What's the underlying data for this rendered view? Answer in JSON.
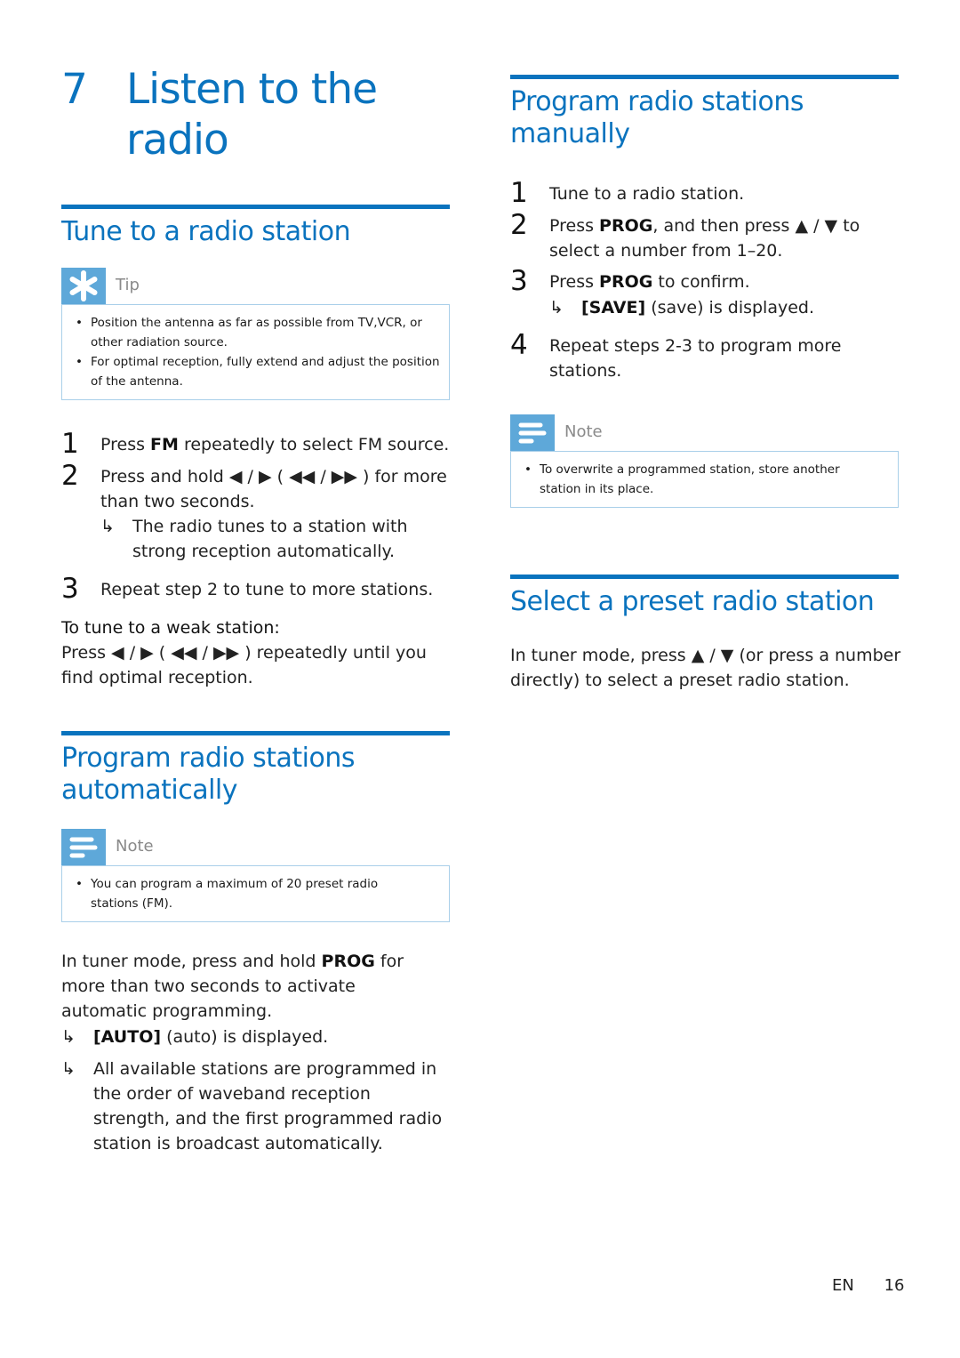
{
  "chapter": {
    "number": "7",
    "title": "Listen to the radio"
  },
  "left": {
    "tune": {
      "heading": "Tune to a radio station",
      "tip": {
        "label": "Tip",
        "icon": "asterisk-icon",
        "items": [
          "Position the antenna as far as possible from TV,VCR, or other radiation source.",
          "For optimal reception, fully extend and adjust the position of the antenna."
        ]
      },
      "steps": [
        {
          "n": "1",
          "pre": "Press ",
          "bold": "FM",
          "post": " repeatedly to select FM source."
        },
        {
          "n": "2",
          "text": "Press and hold ◀ / ▶ ( ◀◀ / ▶▶ ) for more than two seconds."
        },
        {
          "n": "3",
          "text": "Repeat step 2 to tune to more stations."
        }
      ],
      "step2_result": "The radio tunes to a station with strong reception automatically.",
      "weak_heading": "To tune to a weak station:",
      "weak_text": "Press ◀ / ▶ ( ◀◀ / ▶▶ ) repeatedly until you find optimal reception."
    },
    "auto": {
      "heading": "Program radio stations automatically",
      "note": {
        "label": "Note",
        "icon": "note-lines-icon",
        "items": [
          "You can program a maximum of 20 preset radio stations (FM)."
        ]
      },
      "intro_pre": "In tuner mode, press and hold ",
      "intro_bold": "PROG",
      "intro_post": " for more than two seconds to activate automatic programming.",
      "results": [
        {
          "bold": "[AUTO]",
          "text": " (auto) is displayed."
        },
        {
          "bold": "",
          "text": "All available stations are programmed in the order of waveband reception strength, and the first programmed radio station is broadcast automatically."
        }
      ]
    }
  },
  "right": {
    "manual": {
      "heading": "Program radio stations manually",
      "steps": [
        {
          "n": "1",
          "pre": "Tune to a radio station.",
          "bold": "",
          "post": ""
        },
        {
          "n": "2",
          "pre": "Press ",
          "bold": "PROG",
          "post": ", and then press ▲ / ▼ to select a number from 1–20."
        },
        {
          "n": "3",
          "pre": "Press ",
          "bold": "PROG",
          "post": " to confirm."
        },
        {
          "n": "4",
          "pre": "Repeat steps 2-3 to program more stations.",
          "bold": "",
          "post": ""
        }
      ],
      "step3_result": {
        "bold": "[SAVE]",
        "text": " (save) is displayed."
      },
      "note": {
        "label": "Note",
        "icon": "note-lines-icon",
        "items": [
          "To overwrite a programmed station, store another station in its place."
        ]
      }
    },
    "preset": {
      "heading": "Select a preset radio station",
      "text": "In tuner mode, press ▲ / ▼ (or press a number directly) to select a preset radio station."
    }
  },
  "footer": {
    "lang": "EN",
    "page": "16"
  },
  "symbols": {
    "result_arrow": "↳",
    "bullet": "•"
  },
  "colors": {
    "accent": "#0a73be",
    "callout_icon_bg": "#5ea8d9",
    "callout_border": "#a9cfe9"
  }
}
